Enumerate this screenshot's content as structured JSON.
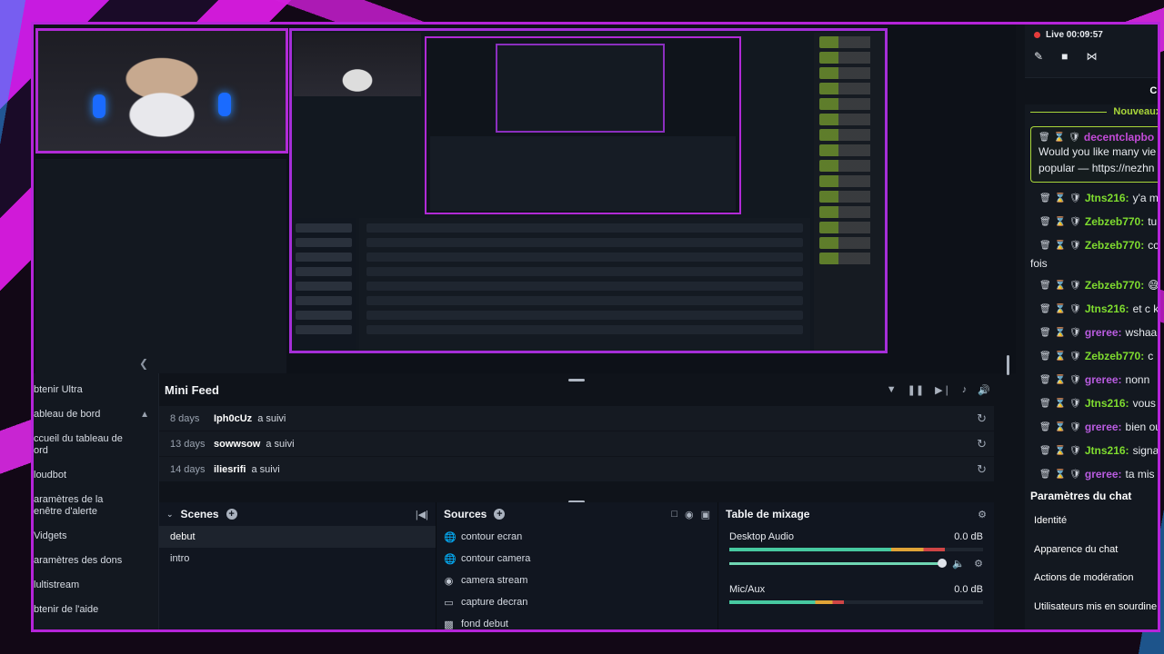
{
  "left_nav": {
    "items": [
      {
        "label": "btenir Ultra"
      },
      {
        "label": "ableau de bord",
        "expanded": true
      },
      {
        "label": "ccueil du tableau de\nord"
      },
      {
        "label": "loudbot"
      },
      {
        "label": "aramètres de la\nenêtre d'alerte"
      },
      {
        "label": "Vidgets"
      },
      {
        "label": "aramètres des dons"
      },
      {
        "label": "lultistream"
      },
      {
        "label": "btenir de l'aide"
      }
    ]
  },
  "mini_feed": {
    "title": "Mini Feed",
    "rows": [
      {
        "ago": "8 days",
        "user": "Iph0cUz",
        "action": "a suivi"
      },
      {
        "ago": "13 days",
        "user": "sowwsow",
        "action": "a suivi"
      },
      {
        "ago": "14 days",
        "user": "iliesrifi",
        "action": "a suivi"
      }
    ]
  },
  "scenes": {
    "title": "Scenes",
    "items": [
      {
        "label": "debut",
        "active": true
      },
      {
        "label": "intro",
        "active": false
      }
    ]
  },
  "sources": {
    "title": "Sources",
    "items": [
      {
        "label": "contour ecran",
        "icon": "globe-icon"
      },
      {
        "label": "contour camera",
        "icon": "globe-icon"
      },
      {
        "label": "camera stream",
        "icon": "webcam-icon"
      },
      {
        "label": "capture decran",
        "icon": "monitor-icon"
      },
      {
        "label": "fond debut",
        "icon": "image-icon"
      }
    ]
  },
  "mixer": {
    "title": "Table de mixage",
    "channels": [
      {
        "name": "Desktop Audio",
        "db": "0.0 dB",
        "level": 0.85,
        "volume": 1.0
      },
      {
        "name": "Mic/Aux",
        "db": "0.0 dB",
        "level": 0.45,
        "volume": 1.0
      }
    ]
  },
  "chat": {
    "live_label": "Live 00:09:57",
    "header": "Ch",
    "new_label": "Nouveaux",
    "highlighted": {
      "user": "decentclapbo",
      "user_color": "#c34bd8",
      "line1": "Would you like many vie",
      "line2": "popular — https://nezhn"
    },
    "messages": [
      {
        "user": "Jtns216",
        "text": "y'a m",
        "color": "#7fdc2f"
      },
      {
        "user": "Zebzeb770",
        "text": "tu",
        "color": "#7fdc2f"
      },
      {
        "user": "Zebzeb770",
        "text": "cc",
        "color": "#7fdc2f",
        "cont": "fois"
      },
      {
        "user": "Zebzeb770",
        "text": "😅",
        "color": "#7fdc2f"
      },
      {
        "user": "Jtns216",
        "text": "et c k",
        "color": "#7fdc2f"
      },
      {
        "user": "greree",
        "text": "wshaa",
        "color": "#b95ce0"
      },
      {
        "user": "Zebzeb770",
        "text": "c",
        "color": "#7fdc2f"
      },
      {
        "user": "greree",
        "text": "nonn",
        "color": "#b95ce0"
      },
      {
        "user": "Jtns216",
        "text": "vous",
        "color": "#7fdc2f"
      },
      {
        "user": "greree",
        "text": "bien ou",
        "color": "#b95ce0"
      },
      {
        "user": "Jtns216",
        "text": "signa",
        "color": "#7fdc2f"
      },
      {
        "user": "greree",
        "text": "ta mis",
        "color": "#b95ce0"
      }
    ],
    "params": {
      "title": "Paramètres du chat",
      "items": [
        "Identité",
        "Apparence du chat",
        "Actions de modération",
        "Utilisateurs mis en sourdine"
      ]
    }
  },
  "colors": {
    "accent_frame": "#b524d9",
    "green": "#a9d63a",
    "live": "#e53b3b"
  }
}
